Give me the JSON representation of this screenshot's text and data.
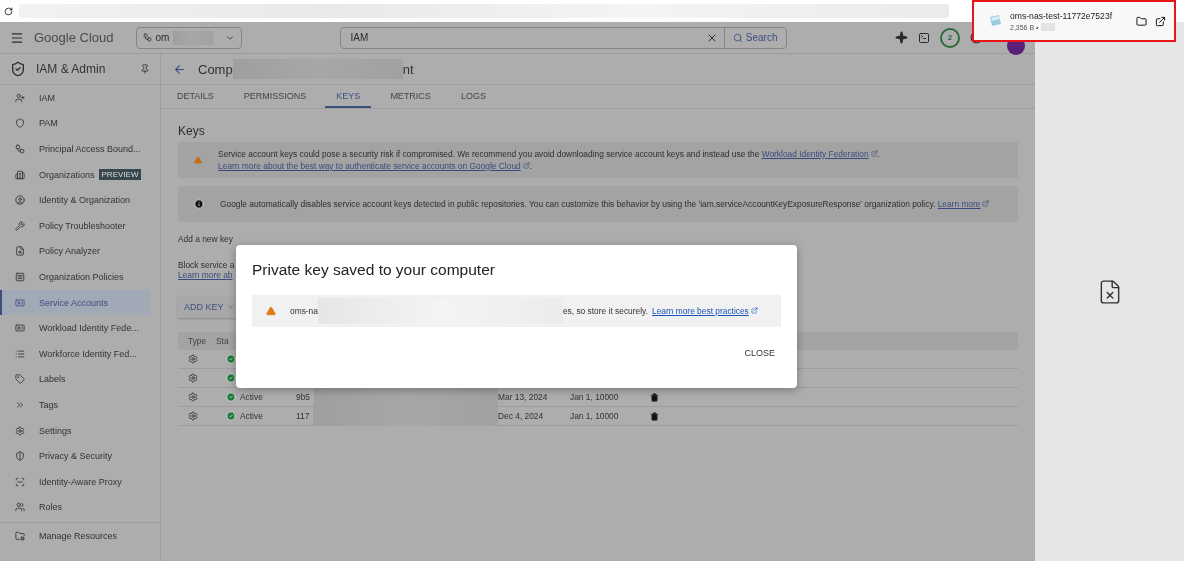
{
  "browser": {
    "download": {
      "filename": "oms-nas-test-11772e7523f",
      "size": "2,356 B •"
    }
  },
  "header": {
    "logo": "Google Cloud",
    "project": "om",
    "search": {
      "value": "IAM"
    },
    "search_button": "Search",
    "notifications": "2"
  },
  "sidebar": {
    "title": "IAM & Admin",
    "items": [
      {
        "label": "IAM",
        "selected": false
      },
      {
        "label": "PAM",
        "selected": false
      },
      {
        "label": "Principal Access Bound...",
        "selected": false
      },
      {
        "label": "Organizations",
        "selected": false,
        "badge": "PREVIEW"
      },
      {
        "label": "Identity & Organization",
        "selected": false
      },
      {
        "label": "Policy Troubleshooter",
        "selected": false
      },
      {
        "label": "Policy Analyzer",
        "selected": false
      },
      {
        "label": "Organization Policies",
        "selected": false
      },
      {
        "label": "Service Accounts",
        "selected": true
      },
      {
        "label": "Workload Identity Fede...",
        "selected": false
      },
      {
        "label": "Workforce Identity Fed...",
        "selected": false
      },
      {
        "label": "Labels",
        "selected": false
      },
      {
        "label": "Tags",
        "selected": false
      },
      {
        "label": "Settings",
        "selected": false
      },
      {
        "label": "Privacy & Security",
        "selected": false
      },
      {
        "label": "Identity-Aware Proxy",
        "selected": false
      },
      {
        "label": "Roles",
        "selected": false
      }
    ],
    "footer_items": [
      {
        "label": "Manage Resources"
      }
    ]
  },
  "page": {
    "title_start": "Comp",
    "title_end": "nt",
    "tabs": [
      {
        "label": "DETAILS",
        "selected": false
      },
      {
        "label": "PERMISSIONS",
        "selected": false
      },
      {
        "label": "KEYS",
        "selected": true
      },
      {
        "label": "METRICS",
        "selected": false
      },
      {
        "label": "LOGS",
        "selected": false
      }
    ]
  },
  "keys": {
    "heading": "Keys",
    "banners": [
      {
        "kind": "warning",
        "parts": [
          {
            "kind": "text",
            "text": "Service account keys could pose a security risk if compromised. We recommend you avoid downloading service account keys and instead use the "
          },
          {
            "kind": "link",
            "text": "Workload Identity Federation"
          },
          {
            "kind": "text",
            "text": ". "
          },
          {
            "kind": "link",
            "text": "Learn more about the best way to authenticate service accounts on Google Cloud"
          },
          {
            "kind": "text",
            "text": "."
          }
        ]
      },
      {
        "kind": "info",
        "parts": [
          {
            "kind": "text",
            "text": "Google automatically disables service account keys detected in public repositories. You can customize this behavior by using the 'iam.serviceAccountKeyExposureResponse' organization policy. "
          },
          {
            "kind": "link",
            "text": "Learn more"
          }
        ]
      }
    ],
    "add_text": "Add a new key",
    "block_text": "Block service a",
    "block_link": "Learn more ab",
    "add_button": "ADD KEY",
    "table": {
      "columns": [
        "Type",
        "Sta"
      ],
      "rows": [
        {
          "kind": "covered"
        },
        {
          "kind": "covered"
        },
        {
          "kind": "full",
          "status": "Active",
          "key_id": "9b5",
          "created": "Mar 13, 2024",
          "expires": "Jan 1, 10000"
        },
        {
          "kind": "full",
          "status": "Active",
          "key_id": "117",
          "created": "Dec 4, 2024",
          "expires": "Jan 1, 10000"
        }
      ]
    }
  },
  "dialog": {
    "title": "Private key saved to your computer",
    "message_start": "oms-na",
    "message_end": "es, so store it securely.",
    "link": "Learn more best practices",
    "button": "CLOSE"
  }
}
